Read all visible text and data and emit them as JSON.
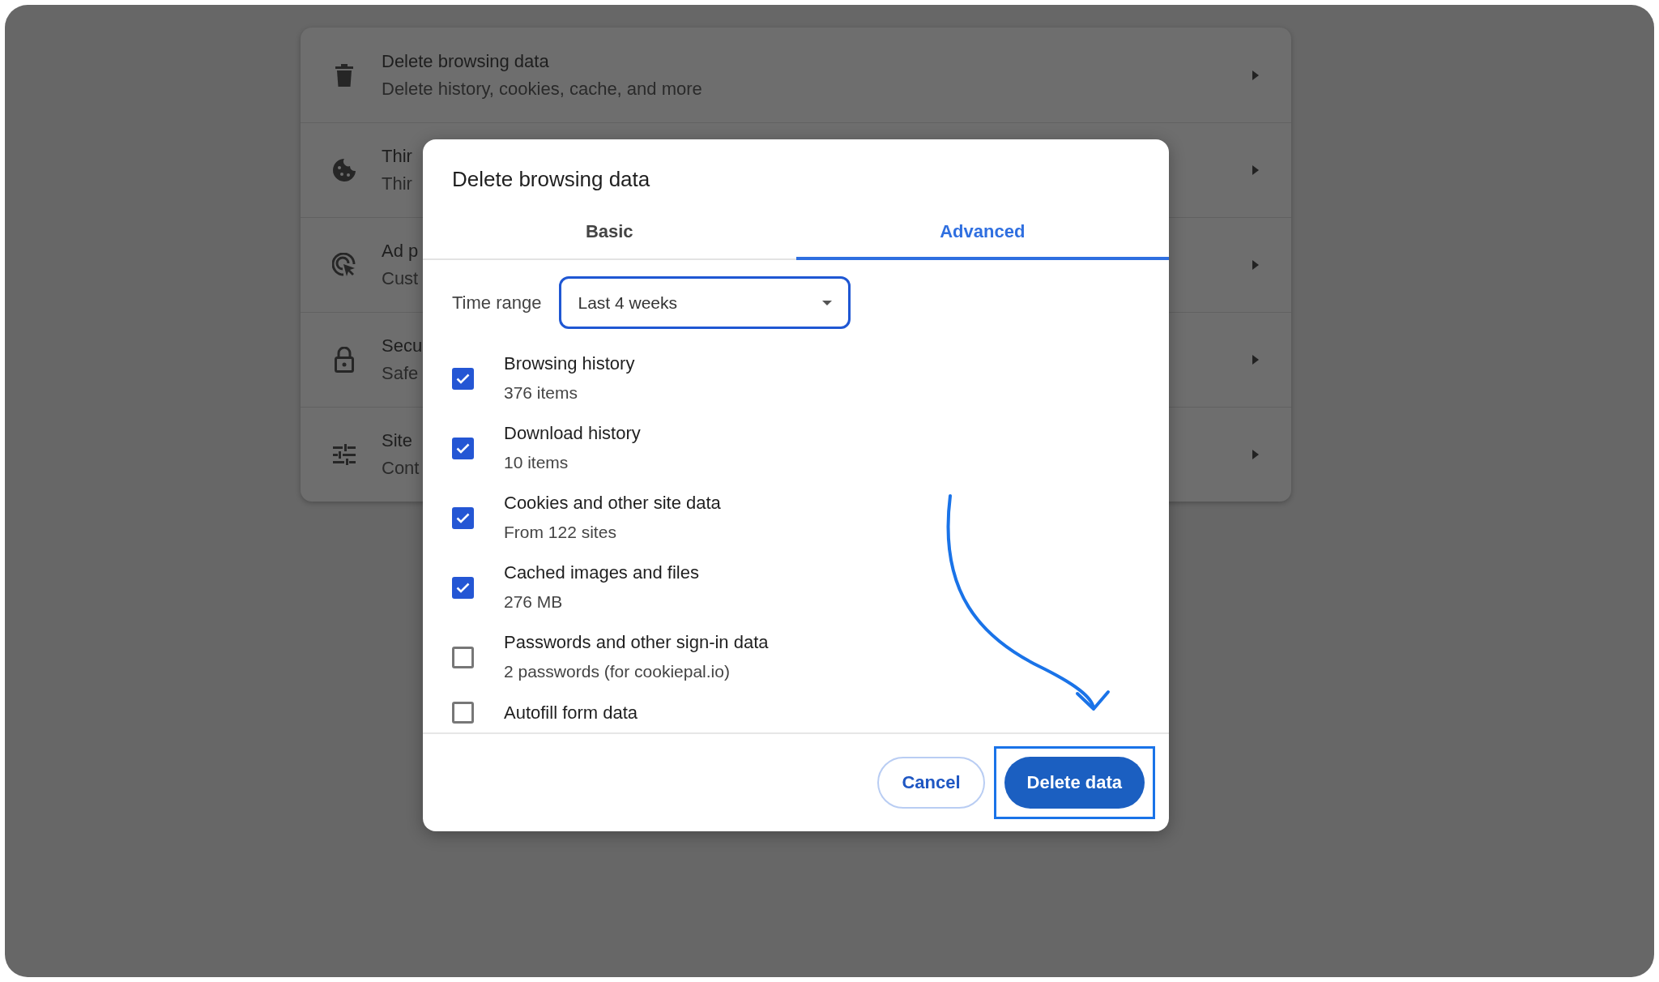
{
  "settings_rows": [
    {
      "title": "Delete browsing data",
      "subtitle": "Delete history, cookies, cache, and more"
    },
    {
      "title": "Thir",
      "subtitle": "Thir"
    },
    {
      "title": "Ad p",
      "subtitle": "Cust"
    },
    {
      "title": "Secu",
      "subtitle": "Safe"
    },
    {
      "title": "Site",
      "subtitle": "Cont"
    }
  ],
  "dialog": {
    "title": "Delete browsing data",
    "tabs": [
      {
        "label": "Basic",
        "selected": false
      },
      {
        "label": "Advanced",
        "selected": true
      }
    ],
    "time_range": {
      "label": "Time range",
      "value": "Last 4 weeks"
    },
    "items": [
      {
        "label": "Browsing history",
        "detail": "376 items",
        "checked": true
      },
      {
        "label": "Download history",
        "detail": "10 items",
        "checked": true
      },
      {
        "label": "Cookies and other site data",
        "detail": "From 122 sites",
        "checked": true
      },
      {
        "label": "Cached images and files",
        "detail": "276 MB",
        "checked": true
      },
      {
        "label": "Passwords and other sign-in data",
        "detail": "2 passwords (for cookiepal.io)",
        "checked": false
      },
      {
        "label": "Autofill form data",
        "checked": false
      }
    ],
    "buttons": [
      {
        "label": "Cancel",
        "kind": "outlined",
        "highlighted": false
      },
      {
        "label": "Delete data",
        "kind": "filled",
        "highlighted": true
      }
    ]
  }
}
